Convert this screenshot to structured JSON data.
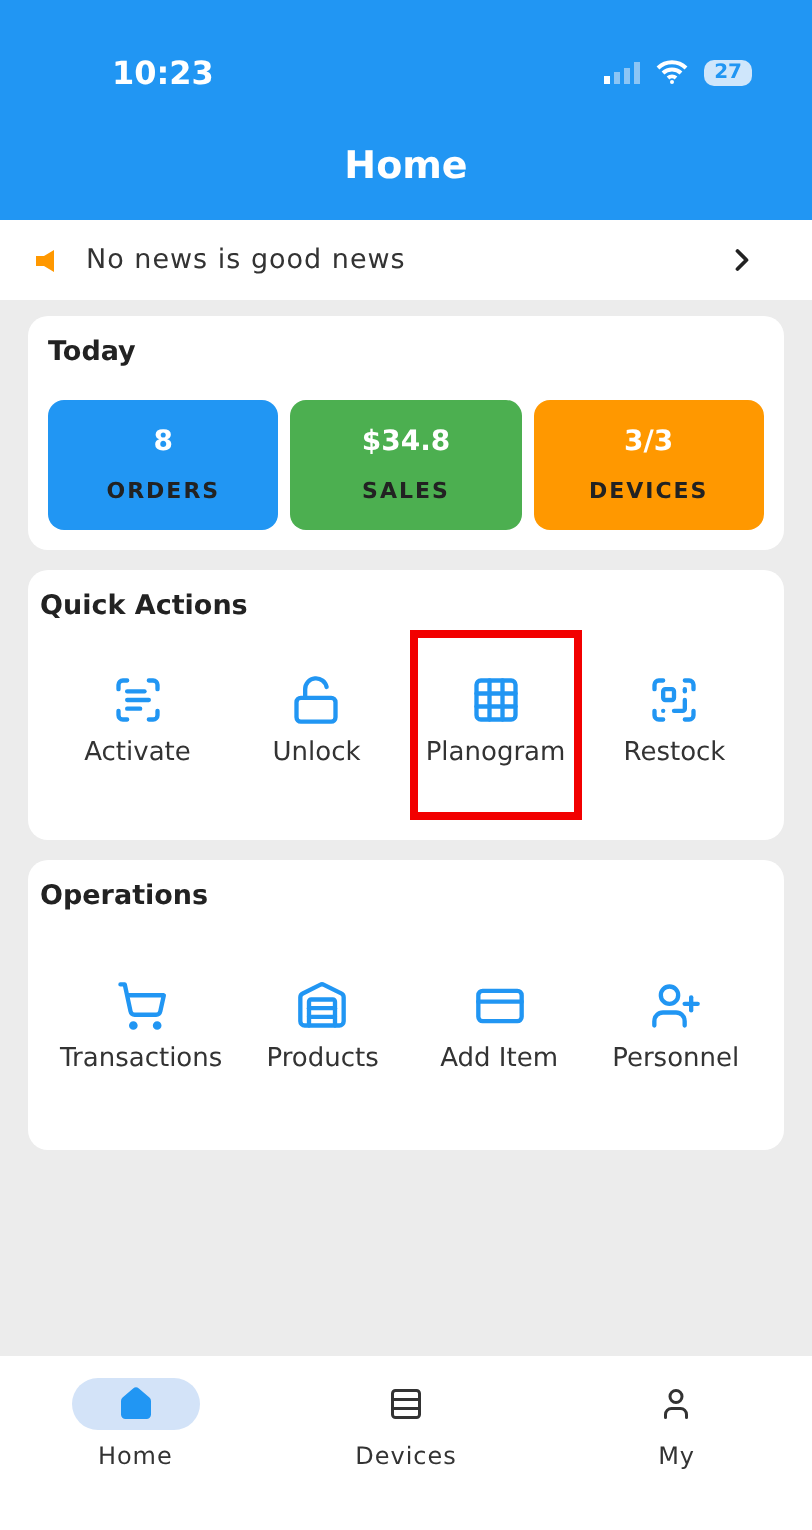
{
  "status_bar": {
    "time": "10:23",
    "battery": "27"
  },
  "header": {
    "title": "Home"
  },
  "news": {
    "text": "No news is good news"
  },
  "today": {
    "title": "Today",
    "stats": [
      {
        "value": "8",
        "label": "ORDERS",
        "color": "#2196f3"
      },
      {
        "value": "$34.8",
        "label": "SALES",
        "color": "#4caf50"
      },
      {
        "value": "3/3",
        "label": "DEVICES",
        "color": "#ff9800"
      }
    ]
  },
  "quick_actions": {
    "title": "Quick Actions",
    "items": [
      {
        "label": "Activate",
        "kind": "scan",
        "highlighted": false
      },
      {
        "label": "Unlock",
        "kind": "unlock",
        "highlighted": false
      },
      {
        "label": "Planogram",
        "kind": "grid",
        "highlighted": true
      },
      {
        "label": "Restock",
        "kind": "qr",
        "highlighted": false
      }
    ]
  },
  "operations": {
    "title": "Operations",
    "items": [
      {
        "label": "Transactions",
        "kind": "cart"
      },
      {
        "label": "Products",
        "kind": "warehouse"
      },
      {
        "label": "Add Item",
        "kind": "card-add"
      },
      {
        "label": "Personnel",
        "kind": "user-add"
      }
    ]
  },
  "tab_bar": [
    {
      "label": "Home",
      "kind": "home",
      "selected": true
    },
    {
      "label": "Devices",
      "kind": "list",
      "selected": false
    },
    {
      "label": "My",
      "kind": "user",
      "selected": false
    }
  ]
}
